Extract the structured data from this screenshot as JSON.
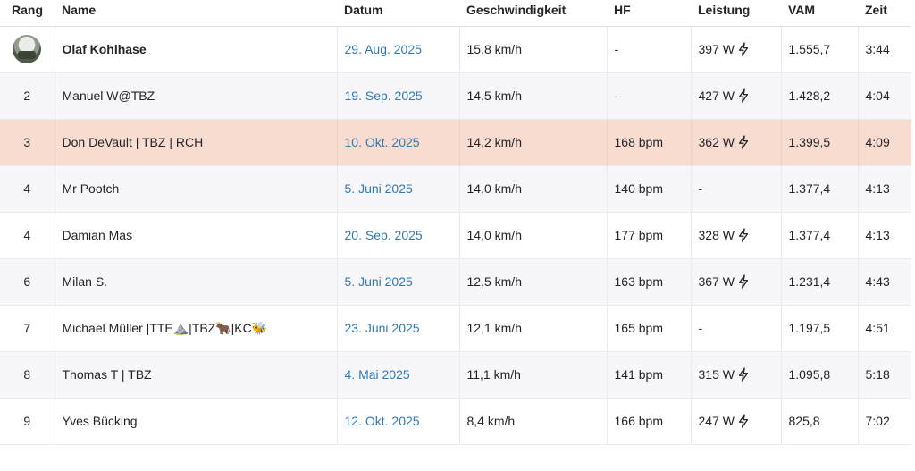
{
  "columns": {
    "rank": "Rang",
    "name": "Name",
    "date": "Datum",
    "speed": "Geschwindigkeit",
    "hr": "HF",
    "power": "Leistung",
    "vam": "VAM",
    "time": "Zeit"
  },
  "rows": [
    {
      "rank": "",
      "name": "Olaf Kohlhase",
      "date": "29. Aug. 2025",
      "speed": "15,8 km/h",
      "hr": "-",
      "power": "397 W",
      "vam": "1.555,7",
      "time": "3:44"
    },
    {
      "rank": "2",
      "name": "Manuel W@TBZ",
      "date": "19. Sep. 2025",
      "speed": "14,5 km/h",
      "hr": "-",
      "power": "427 W",
      "vam": "1.428,2",
      "time": "4:04"
    },
    {
      "rank": "3",
      "name": "Don DeVault | TBZ | RCH",
      "date": "10. Okt. 2025",
      "speed": "14,2 km/h",
      "hr": "168 bpm",
      "power": "362 W",
      "vam": "1.399,5",
      "time": "4:09"
    },
    {
      "rank": "4",
      "name": "Mr Pootch",
      "date": "5. Juni 2025",
      "speed": "14,0 km/h",
      "hr": "140 bpm",
      "power": "-",
      "vam": "1.377,4",
      "time": "4:13"
    },
    {
      "rank": "4",
      "name": "Damian Mas",
      "date": "20. Sep. 2025",
      "speed": "14,0 km/h",
      "hr": "177 bpm",
      "power": "328 W",
      "vam": "1.377,4",
      "time": "4:13"
    },
    {
      "rank": "6",
      "name": "Milan S.",
      "date": "5. Juni 2025",
      "speed": "12,5 km/h",
      "hr": "163 bpm",
      "power": "367 W",
      "vam": "1.231,4",
      "time": "4:43"
    },
    {
      "rank": "7",
      "name": "Michael Müller |TTE⛰️|TBZ🐂|KC🐝",
      "date": "23. Juni 2025",
      "speed": "12,1 km/h",
      "hr": "165 bpm",
      "power": "-",
      "vam": "1.197,5",
      "time": "4:51"
    },
    {
      "rank": "8",
      "name": "Thomas T | TBZ",
      "date": "4. Mai 2025",
      "speed": "11,1 km/h",
      "hr": "141 bpm",
      "power": "315 W",
      "vam": "1.095,8",
      "time": "5:18"
    },
    {
      "rank": "9",
      "name": "Yves Bücking",
      "date": "12. Okt. 2025",
      "speed": "8,4 km/h",
      "hr": "166 bpm",
      "power": "247 W",
      "vam": "825,8",
      "time": "7:02"
    }
  ],
  "rank1_avatar": "avatar-photo",
  "highlight_row_index": 2,
  "power_icon": "lightning-bolt-icon",
  "colors": {
    "date_link": "#2f79b5",
    "highlight_row": "#f8dccf",
    "alt_row": "#f7f7fa"
  }
}
